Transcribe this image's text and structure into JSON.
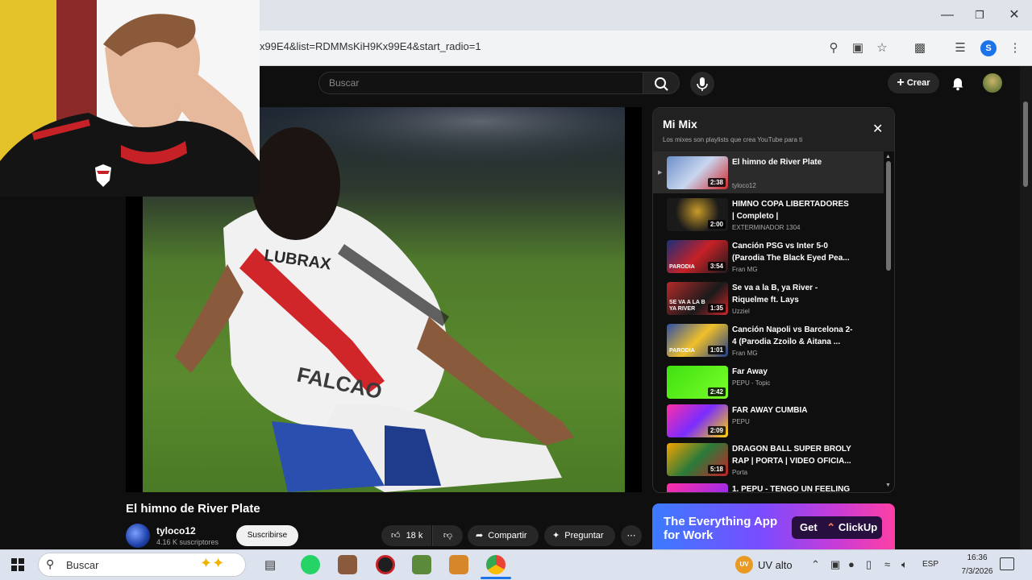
{
  "browser": {
    "url": "x99E4&list=RDMMsKiH9Kx99E4&start_radio=1",
    "profile_initial": "S"
  },
  "header": {
    "search_placeholder": "Buscar",
    "create_label": "Crear"
  },
  "video": {
    "title": "El himno de River Plate",
    "jersey_text": "LUBRAX",
    "jersey_name": "FALCAO",
    "channel": "tyloco12",
    "subscribers": "4.16 K suscriptores",
    "subscribe_label": "Suscribirse",
    "likes": "18 k",
    "share_label": "Compartir",
    "ask_label": "Preguntar"
  },
  "mix": {
    "title": "Mi Mix",
    "subtitle": "Los mixes son playlists que crea YouTube para ti",
    "items": [
      {
        "title": "El himno de River Plate",
        "channel": "tyloco12",
        "duration": "2:38",
        "active": true
      },
      {
        "title": "HIMNO COPA LIBERTADORES | Completo |",
        "channel": "EXTERMINADOR 1304",
        "duration": "2:00"
      },
      {
        "title": "Canción PSG vs Inter 5-0 (Parodia The Black Eyed Pea...",
        "channel": "Fran MG",
        "duration": "3:54",
        "thumb_label": "PARODIA"
      },
      {
        "title": "Se va a la B, ya River - Riquelme ft. Lays",
        "channel": "Uzziel",
        "duration": "1:35",
        "thumb_label": "SE VA A LA B YA RIVER"
      },
      {
        "title": "Canción Napoli vs Barcelona 2-4 (Parodia Zzoilo & Aitana ...",
        "channel": "Fran MG",
        "duration": "1:01",
        "thumb_label": "PARODIA"
      },
      {
        "title": "Far Away",
        "channel": "PEPU - Topic",
        "duration": "2:42"
      },
      {
        "title": "FAR AWAY CUMBIA",
        "channel": "PEPU",
        "duration": "2:09"
      },
      {
        "title": "DRAGON BALL SUPER BROLY RAP | PORTA | VIDEO OFICIA...",
        "channel": "Porta",
        "duration": "5:18"
      },
      {
        "title": "1. PEPU - TENGO UN FEELING",
        "channel": "",
        "duration": ""
      }
    ]
  },
  "ad": {
    "headline": "The Everything App for Work",
    "cta": "Get",
    "brand": "ClickUp"
  },
  "taskbar": {
    "search_label": "Buscar",
    "weather": "UV alto",
    "weather_badge": "UV",
    "language": "ESP",
    "time": "16:36",
    "date": "7/3/2026"
  },
  "colors": {
    "yt_bg": "#0f0f0f",
    "accent_ad": "#7a4cff",
    "river_red": "#d0262a"
  }
}
